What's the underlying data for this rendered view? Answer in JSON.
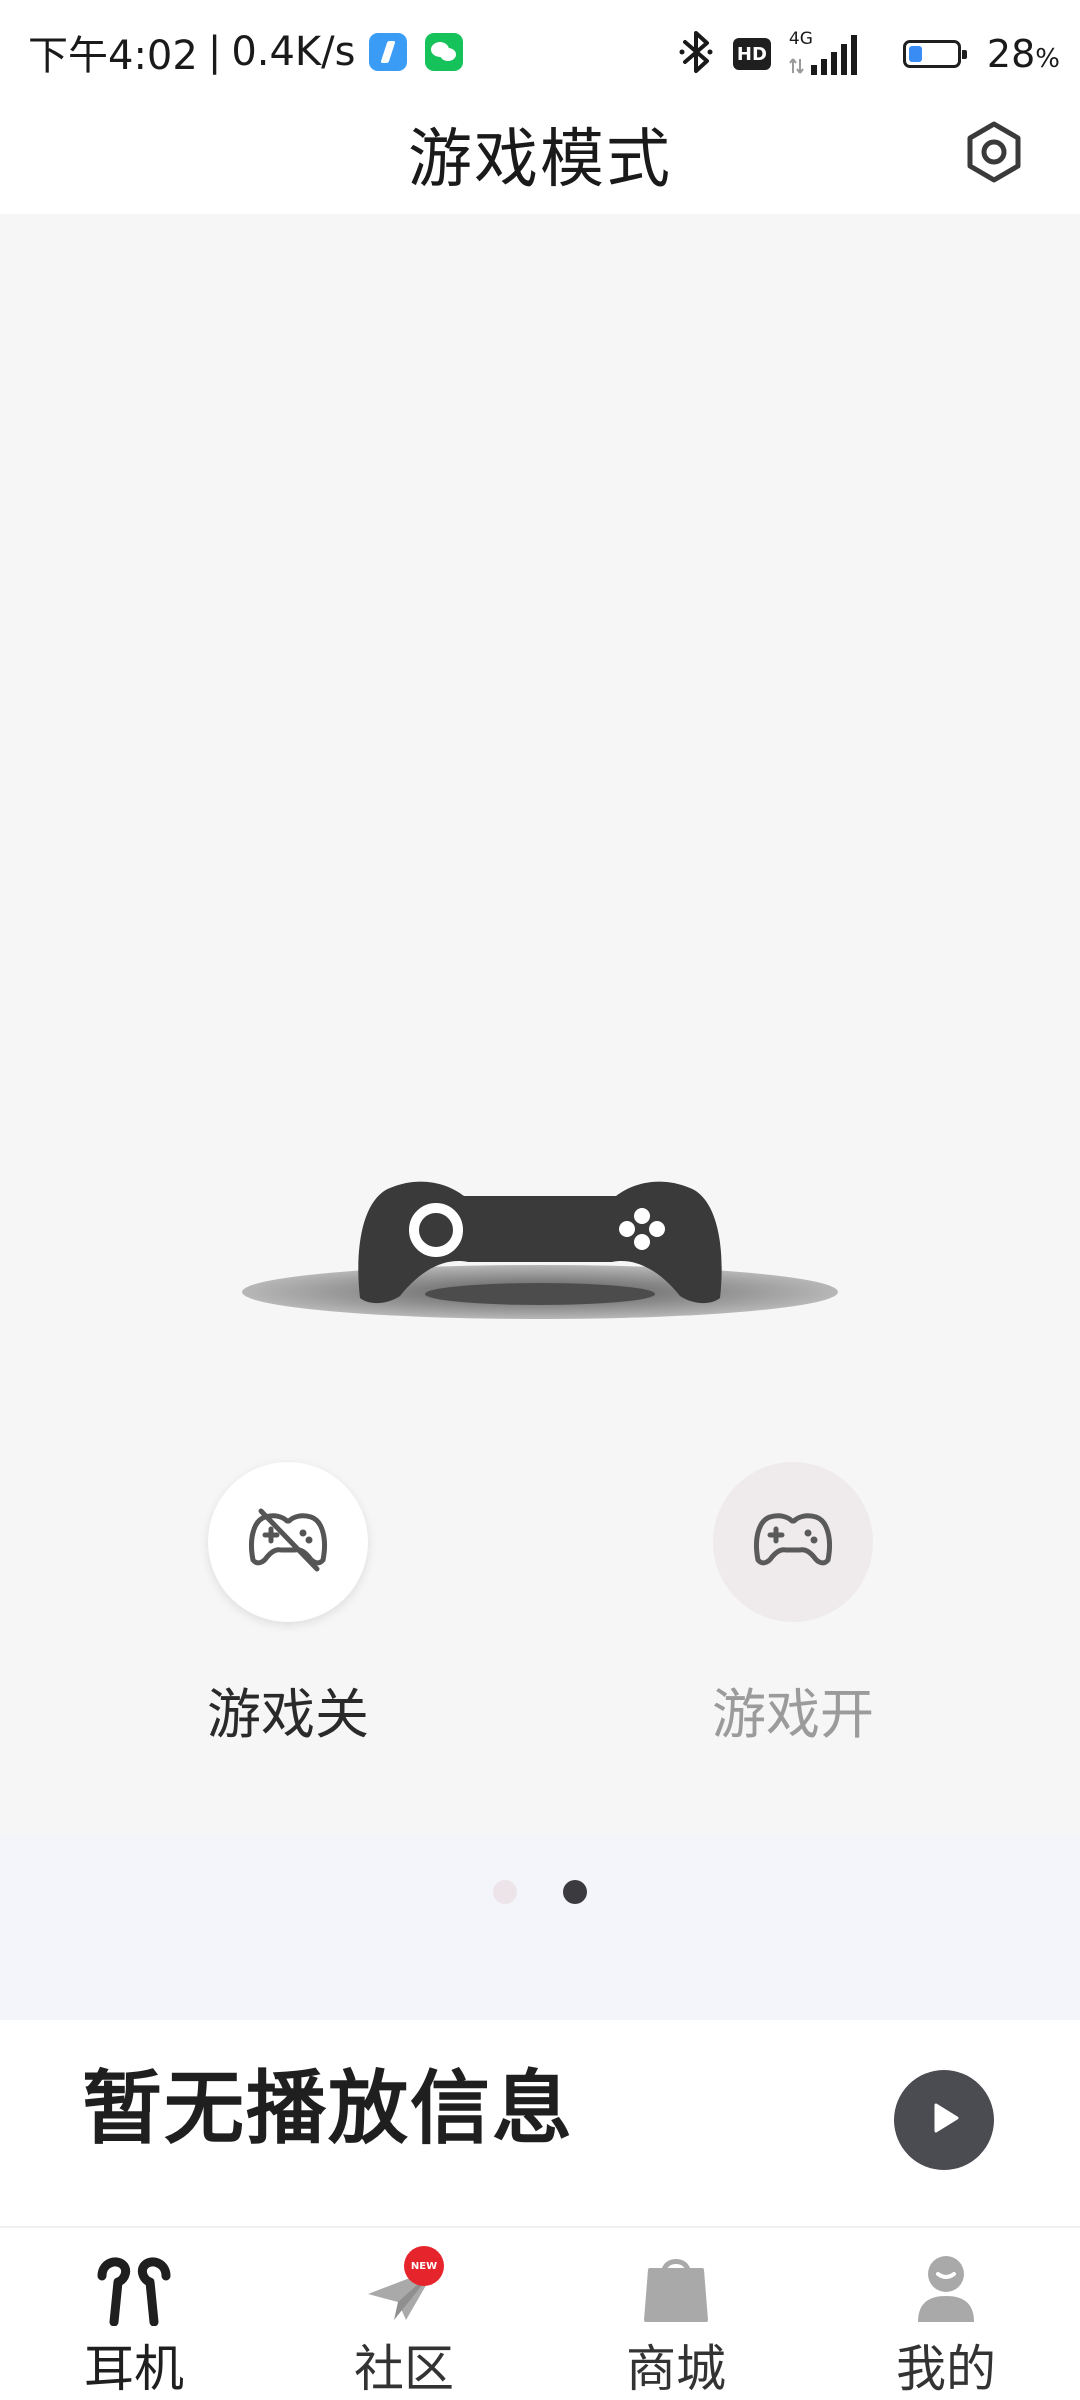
{
  "status_bar": {
    "time": "下午4:02",
    "separator": "|",
    "net_speed": "0.4K/s",
    "hd_label": "HD",
    "network_type": "4G",
    "battery_level": 0.28,
    "battery_percent": "28",
    "battery_unit": "%",
    "icons": [
      "bluetooth-icon",
      "hd-icon",
      "signal-icon",
      "battery-icon"
    ]
  },
  "header": {
    "title": "游戏模式",
    "settings_icon": "gear-icon"
  },
  "game_mode": {
    "options": [
      {
        "label": "游戏关",
        "icon": "gamepad-off-icon"
      },
      {
        "label": "游戏开",
        "icon": "gamepad-icon"
      }
    ],
    "illustration_icon": "gamepad-illustration"
  },
  "pager": {
    "total": 2,
    "active_index": 1
  },
  "player": {
    "no_info_text": "暂无播放信息",
    "play_icon": "play-icon"
  },
  "bottom_nav": {
    "items": [
      {
        "label": "耳机",
        "icon": "earbuds-icon"
      },
      {
        "label": "社区",
        "icon": "paper-plane-icon",
        "badge": "NEW"
      },
      {
        "label": "商城",
        "icon": "shopping-bag-icon"
      },
      {
        "label": "我的",
        "icon": "user-icon"
      }
    ],
    "active_index": 0
  },
  "colors": {
    "background": "#f6f6f6",
    "controller": "#3a3a3a",
    "active_dot": "#3b3b3f",
    "inactive_dot": "#ece4e8",
    "play_button": "#4a4c52",
    "badge": "#e6242b"
  }
}
